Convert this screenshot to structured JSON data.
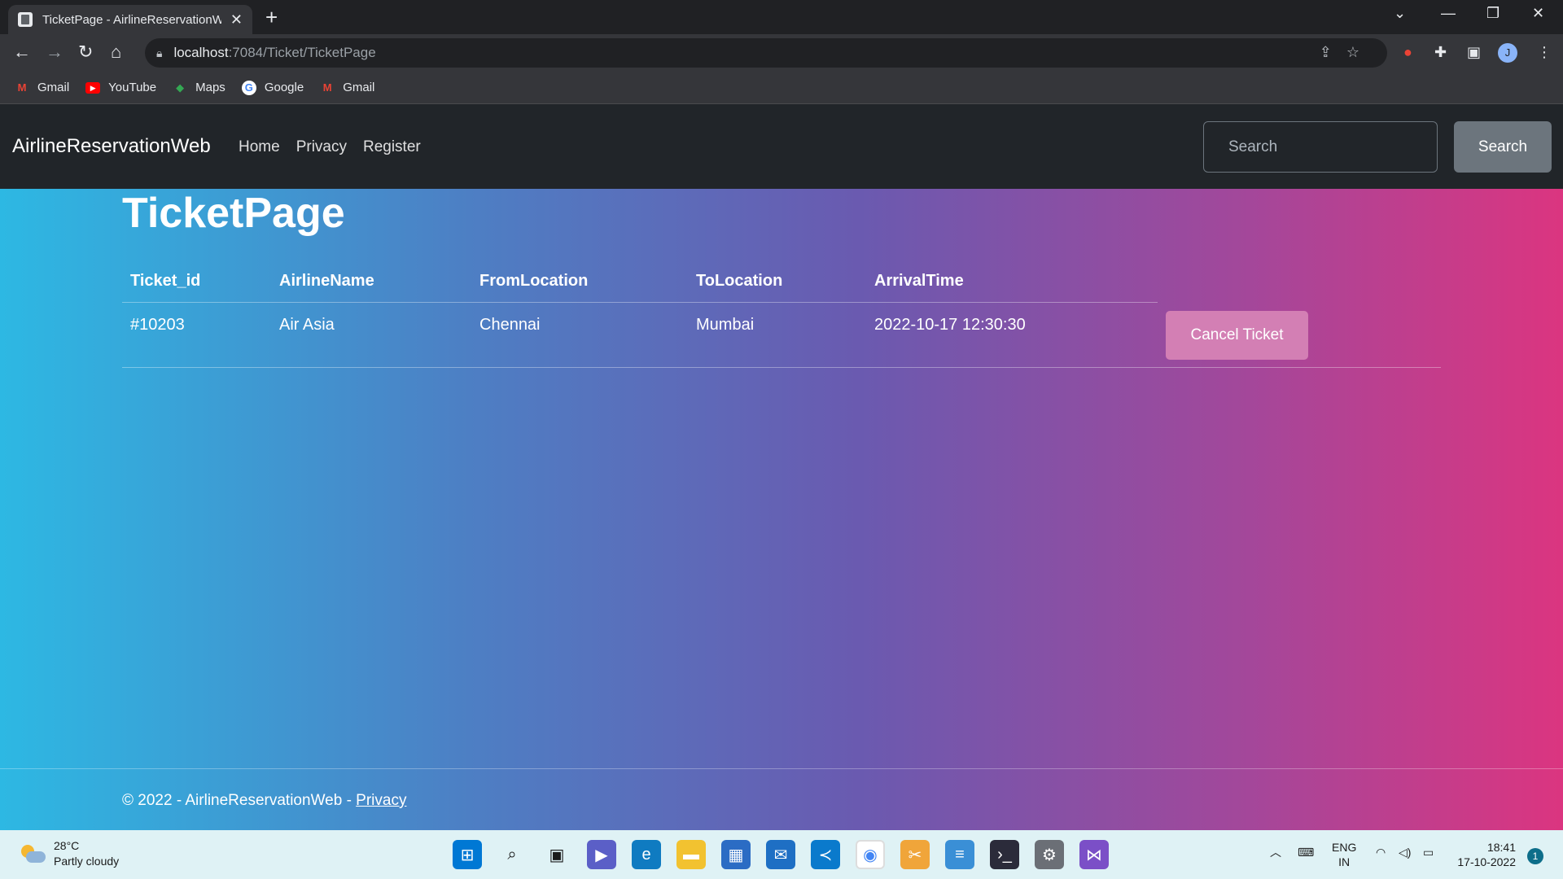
{
  "browser": {
    "tab_title": "TicketPage - AirlineReservationW",
    "tab_close": "✕",
    "new_tab": "+",
    "url_host": "localhost",
    "url_path": ":7084/Ticket/TicketPage",
    "bookmarks": [
      {
        "label": "Gmail",
        "icon": "gmail-icon",
        "color": "#ea4335"
      },
      {
        "label": "YouTube",
        "icon": "youtube-icon",
        "color": "#ff0000"
      },
      {
        "label": "Maps",
        "icon": "maps-icon",
        "color": "#34a853"
      },
      {
        "label": "Google",
        "icon": "google-icon",
        "color": "#4285f4"
      },
      {
        "label": "Gmail",
        "icon": "gmail-icon",
        "color": "#ea4335"
      }
    ],
    "profile_initial": "J"
  },
  "navbar": {
    "brand": "AirlineReservationWeb",
    "links": [
      "Home",
      "Privacy",
      "Register"
    ],
    "search_placeholder": "Search",
    "search_button": "Search"
  },
  "page": {
    "title": "TicketPage",
    "table": {
      "headers": [
        "Ticket_id",
        "AirlineName",
        "FromLocation",
        "ToLocation",
        "ArrivalTime"
      ],
      "rows": [
        {
          "ticket_id": "#10203",
          "airline": "Air Asia",
          "from": "Chennai",
          "to": "Mumbai",
          "arrival": "2022-10-17 12:30:30"
        }
      ],
      "cancel_label": "Cancel Ticket"
    },
    "footer_text": "© 2022 - AirlineReservationWeb - ",
    "footer_link": "Privacy"
  },
  "taskbar": {
    "temperature": "28°C",
    "weather": "Partly cloudy",
    "language_1": "ENG",
    "language_2": "IN",
    "time": "18:41",
    "date": "17-10-2022",
    "notification_count": "1"
  }
}
